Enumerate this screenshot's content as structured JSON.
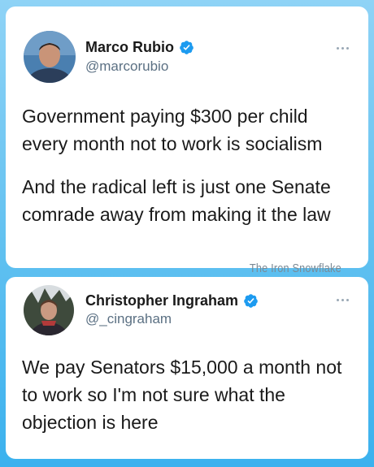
{
  "tweets": [
    {
      "display_name": "Marco Rubio",
      "handle": "@marcorubio",
      "verified": true,
      "paragraphs": [
        "Government paying $300 per child every month not to work is socialism",
        "And the radical left is just one Senate comrade away from making it the law"
      ]
    },
    {
      "display_name": "Christopher Ingraham",
      "handle": "@_cingraham",
      "verified": true,
      "paragraphs": [
        "We pay Senators $15,000 a month not to work so I'm not sure what the objection is here"
      ]
    }
  ],
  "watermark": "The Iron Snowflake",
  "icons": {
    "verified": "verified-badge-icon",
    "more": "more-options-icon"
  },
  "colors": {
    "verified_blue": "#1d9bf0",
    "background_top": "#8fd3f6",
    "background_bottom": "#3bb1ee",
    "text": "#1a1a1a",
    "handle": "#5b7083"
  }
}
